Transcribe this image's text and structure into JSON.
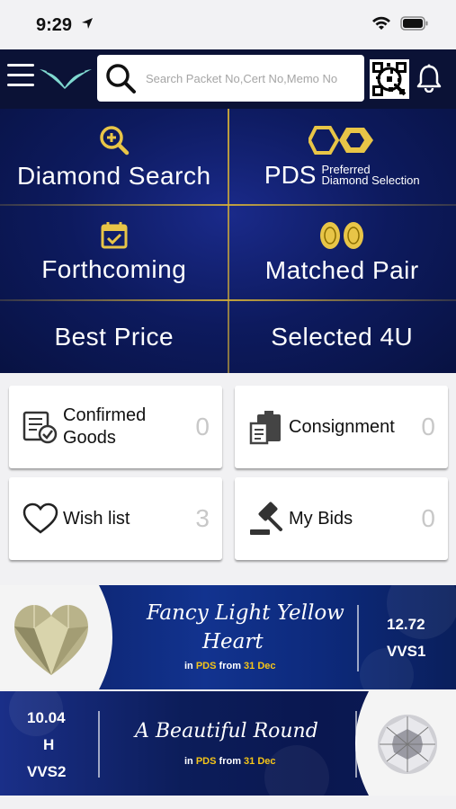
{
  "status": {
    "time": "9:29"
  },
  "search": {
    "placeholder": "Search Packet No,Cert No,Memo No"
  },
  "menu": {
    "diamond_search": "Diamond Search",
    "pds_big": "PDS",
    "pds_small_1": "Preferred",
    "pds_small_2": "Diamond Selection",
    "forthcoming": "Forthcoming",
    "matched_pair": "Matched Pair",
    "best_price": "Best Price",
    "selected_4u": "Selected 4U"
  },
  "cards": [
    {
      "label_1": "Confirmed",
      "label_2": "Goods",
      "count": "0",
      "icon": "checklist-icon"
    },
    {
      "label_1": "Consignment",
      "count": "0",
      "icon": "consignment-icon"
    },
    {
      "label_1": "Wish list",
      "count": "3",
      "icon": "heart-icon"
    },
    {
      "label_1": "My Bids",
      "count": "0",
      "icon": "gavel-icon"
    }
  ],
  "banner1": {
    "title_1": "Fancy Light Yellow",
    "title_2": "Heart",
    "in": "in",
    "pds": "PDS",
    "from": "from",
    "date": "31 Dec",
    "carat": "12.72",
    "clarity": "VVS1"
  },
  "banner2": {
    "title": "A Beautiful Round",
    "in": "in",
    "pds": "PDS",
    "from": "from",
    "date": "31 Dec",
    "carat": "10.04",
    "color": "H",
    "clarity": "VVS2"
  },
  "colors": {
    "navy": "#0b1236",
    "gold": "#d4af37",
    "accent_yellow": "#f5c518"
  }
}
